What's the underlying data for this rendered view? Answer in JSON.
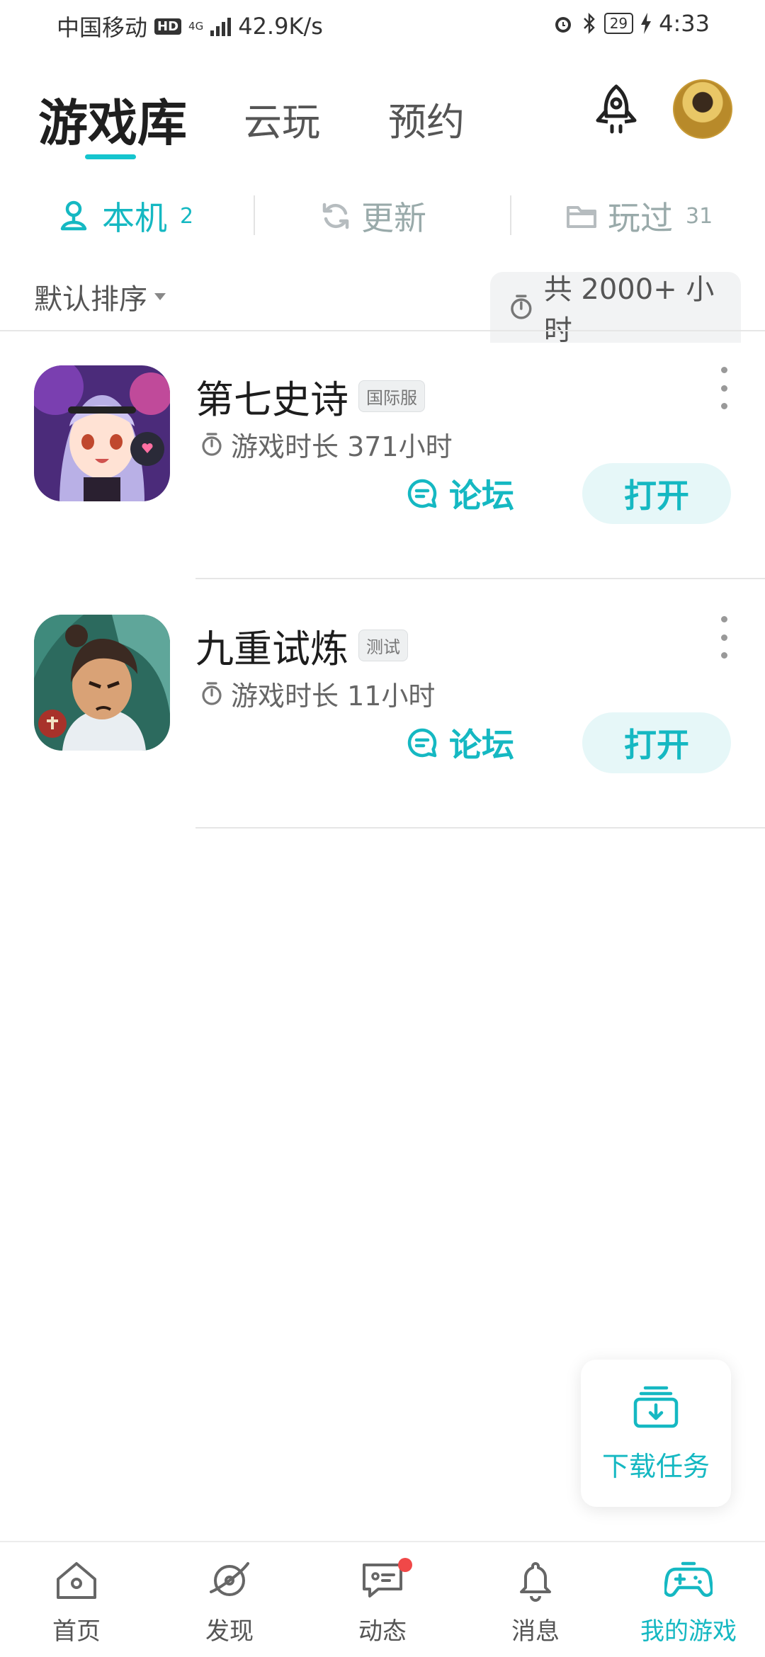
{
  "status_bar": {
    "carrier": "中国移动",
    "hd": "HD",
    "network": "4G",
    "speed": "42.9K/s",
    "battery": "29",
    "time": "4:33"
  },
  "header": {
    "title": "游戏库",
    "tabs": [
      "云玩",
      "预约"
    ]
  },
  "subtabs": [
    {
      "label": "本机",
      "count": "2"
    },
    {
      "label": "更新",
      "count": ""
    },
    {
      "label": "玩过",
      "count": "31"
    }
  ],
  "sort": {
    "label": "默认排序",
    "total": "共 2000+ 小时"
  },
  "games": [
    {
      "name": "第七史诗",
      "tag": "国际服",
      "playtime": "游戏时长 371小时",
      "forum": "论坛",
      "open": "打开"
    },
    {
      "name": "九重试炼",
      "tag": "测试",
      "playtime": "游戏时长 11小时",
      "forum": "论坛",
      "open": "打开"
    }
  ],
  "download_tasks": {
    "label": "下载任务"
  },
  "bottom_nav": [
    {
      "label": "首页"
    },
    {
      "label": "发现"
    },
    {
      "label": "动态"
    },
    {
      "label": "消息"
    },
    {
      "label": "我的游戏"
    }
  ],
  "colors": {
    "accent": "#15b8c2",
    "notification": "#f04848"
  }
}
